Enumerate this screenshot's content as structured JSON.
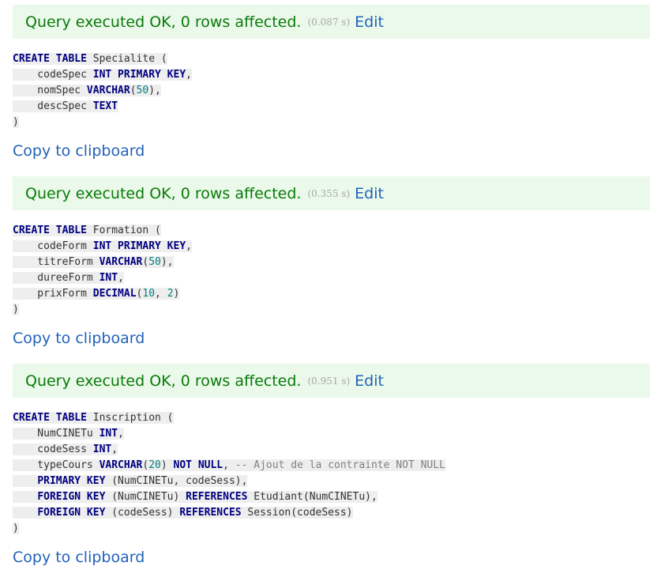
{
  "queries": [
    {
      "message": "Query executed OK, 0 rows affected.",
      "time": "(0.087 s)",
      "edit_label": "Edit",
      "copy_label": "Copy to clipboard",
      "lines": [
        [
          {
            "t": "CREATE TABLE",
            "k": "kw"
          },
          {
            "t": " Specialite (",
            "k": "p"
          }
        ],
        [
          {
            "t": "    codeSpec ",
            "k": "p"
          },
          {
            "t": "INT PRIMARY KEY",
            "k": "kw"
          },
          {
            "t": ",",
            "k": "p"
          }
        ],
        [
          {
            "t": "    nomSpec ",
            "k": "p"
          },
          {
            "t": "VARCHAR",
            "k": "kw"
          },
          {
            "t": "(",
            "k": "p"
          },
          {
            "t": "50",
            "k": "num"
          },
          {
            "t": "),",
            "k": "p"
          }
        ],
        [
          {
            "t": "    descSpec ",
            "k": "p"
          },
          {
            "t": "TEXT",
            "k": "kw"
          }
        ],
        [
          {
            "t": ")",
            "k": "p"
          }
        ]
      ]
    },
    {
      "message": "Query executed OK, 0 rows affected.",
      "time": "(0.355 s)",
      "edit_label": "Edit",
      "copy_label": "Copy to clipboard",
      "lines": [
        [
          {
            "t": "CREATE TABLE",
            "k": "kw"
          },
          {
            "t": " Formation (",
            "k": "p"
          }
        ],
        [
          {
            "t": "    codeForm ",
            "k": "p"
          },
          {
            "t": "INT PRIMARY KEY",
            "k": "kw"
          },
          {
            "t": ",",
            "k": "p"
          }
        ],
        [
          {
            "t": "    titreForm ",
            "k": "p"
          },
          {
            "t": "VARCHAR",
            "k": "kw"
          },
          {
            "t": "(",
            "k": "p"
          },
          {
            "t": "50",
            "k": "num"
          },
          {
            "t": "),",
            "k": "p"
          }
        ],
        [
          {
            "t": "    dureeForm ",
            "k": "p"
          },
          {
            "t": "INT",
            "k": "kw"
          },
          {
            "t": ",",
            "k": "p"
          }
        ],
        [
          {
            "t": "    prixForm ",
            "k": "p"
          },
          {
            "t": "DECIMAL",
            "k": "kw"
          },
          {
            "t": "(",
            "k": "p"
          },
          {
            "t": "10",
            "k": "num"
          },
          {
            "t": ", ",
            "k": "p"
          },
          {
            "t": "2",
            "k": "num"
          },
          {
            "t": ")",
            "k": "p"
          }
        ],
        [
          {
            "t": ")",
            "k": "p"
          }
        ]
      ]
    },
    {
      "message": "Query executed OK, 0 rows affected.",
      "time": "(0.951 s)",
      "edit_label": "Edit",
      "copy_label": "Copy to clipboard",
      "lines": [
        [
          {
            "t": "CREATE TABLE",
            "k": "kw"
          },
          {
            "t": " Inscription (",
            "k": "p"
          }
        ],
        [
          {
            "t": "    NumCINETu ",
            "k": "p"
          },
          {
            "t": "INT",
            "k": "kw"
          },
          {
            "t": ",",
            "k": "p"
          }
        ],
        [
          {
            "t": "    codeSess ",
            "k": "p"
          },
          {
            "t": "INT",
            "k": "kw"
          },
          {
            "t": ",",
            "k": "p"
          }
        ],
        [
          {
            "t": "    typeCours ",
            "k": "p"
          },
          {
            "t": "VARCHAR",
            "k": "kw"
          },
          {
            "t": "(",
            "k": "p"
          },
          {
            "t": "20",
            "k": "num"
          },
          {
            "t": ") ",
            "k": "p"
          },
          {
            "t": "NOT NULL",
            "k": "kw"
          },
          {
            "t": ", ",
            "k": "p"
          },
          {
            "t": "-- Ajout de la contrainte NOT NULL",
            "k": "cm"
          }
        ],
        [
          {
            "t": "    ",
            "k": "p"
          },
          {
            "t": "PRIMARY KEY",
            "k": "kw"
          },
          {
            "t": " (NumCINETu, codeSess),",
            "k": "p"
          }
        ],
        [
          {
            "t": "    ",
            "k": "p"
          },
          {
            "t": "FOREIGN KEY",
            "k": "kw"
          },
          {
            "t": " (NumCINETu) ",
            "k": "p"
          },
          {
            "t": "REFERENCES",
            "k": "kw"
          },
          {
            "t": " Etudiant(NumCINETu),",
            "k": "p"
          }
        ],
        [
          {
            "t": "    ",
            "k": "p"
          },
          {
            "t": "FOREIGN KEY",
            "k": "kw"
          },
          {
            "t": " (codeSess) ",
            "k": "p"
          },
          {
            "t": "REFERENCES",
            "k": "kw"
          },
          {
            "t": " Session(codeSess)",
            "k": "p"
          }
        ],
        [
          {
            "t": ")",
            "k": "p"
          }
        ]
      ]
    }
  ]
}
